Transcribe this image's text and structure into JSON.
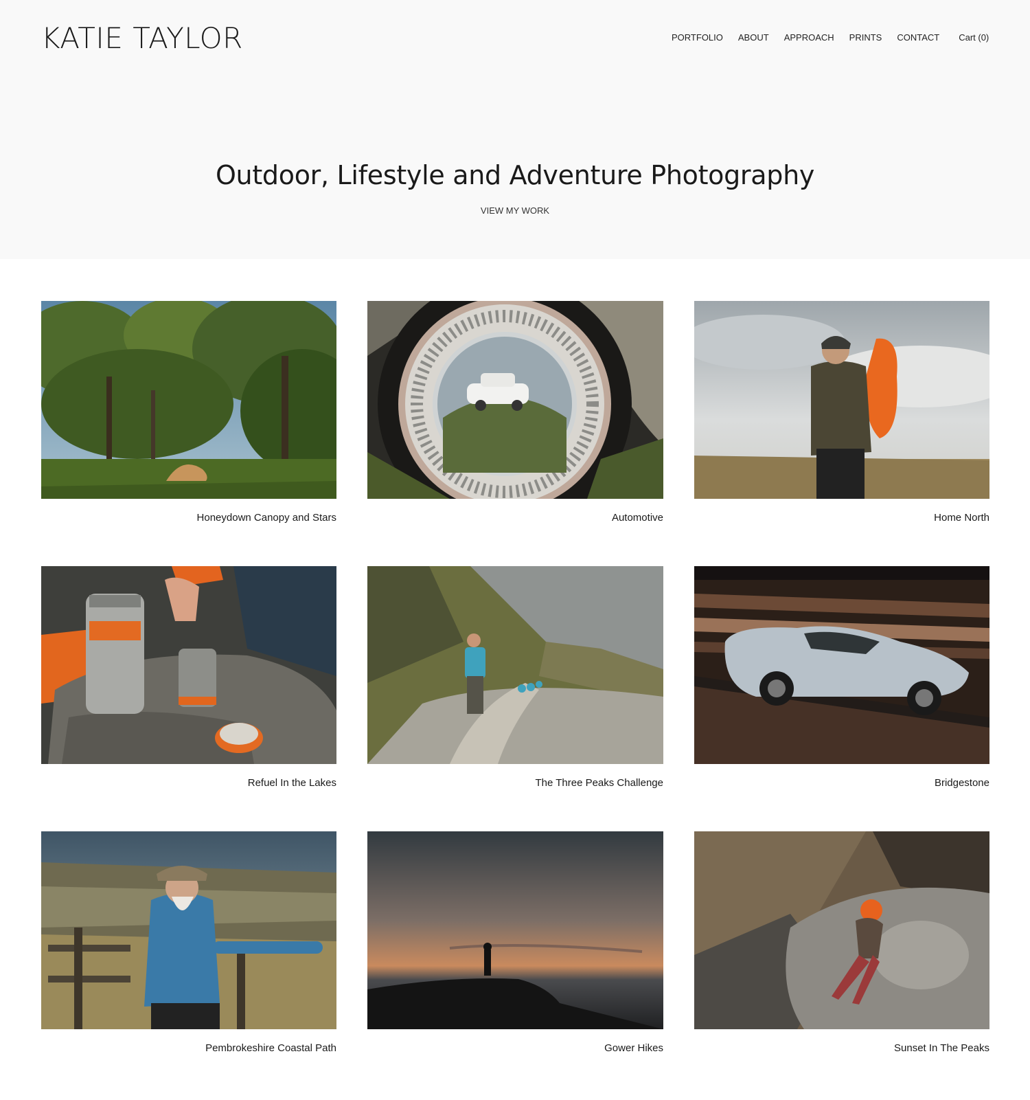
{
  "header": {
    "logo": "KATIE TAYLOR",
    "nav": {
      "items": [
        "PORTFOLIO",
        "ABOUT",
        "APPROACH",
        "PRINTS",
        "CONTACT"
      ],
      "cart": "Cart (0)"
    }
  },
  "hero": {
    "headline": "Outdoor, Lifestyle and Adventure Photography",
    "cta": "VIEW MY WORK"
  },
  "gallery": {
    "items": [
      {
        "caption": "Honeydown Canopy and Stars"
      },
      {
        "caption": "Automotive"
      },
      {
        "caption": "Home North"
      },
      {
        "caption": "Refuel In the Lakes"
      },
      {
        "caption": "The Three Peaks Challenge"
      },
      {
        "caption": "Bridgestone"
      },
      {
        "caption": "Pembrokeshire Coastal Path"
      },
      {
        "caption": "Gower Hikes"
      },
      {
        "caption": "Sunset In The Peaks"
      }
    ]
  },
  "colors": {
    "hero_background": "#f9f9f9",
    "page_background": "#ffffff",
    "text": "#1a1a1a"
  }
}
